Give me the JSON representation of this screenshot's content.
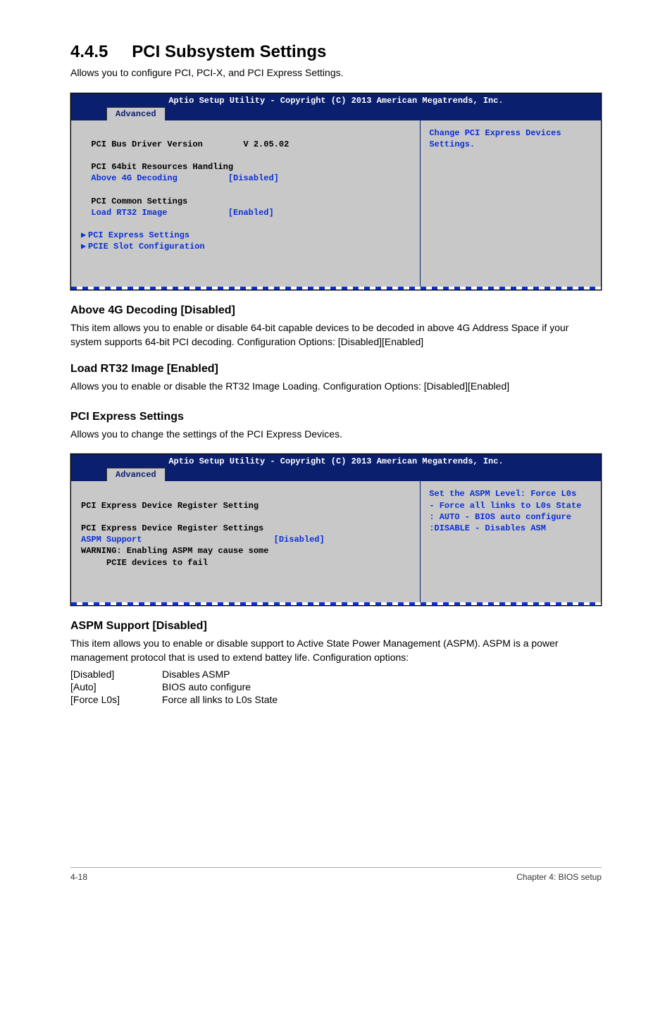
{
  "section": {
    "number": "4.4.5",
    "title": "PCI Subsystem Settings"
  },
  "intro": "Allows you to configure PCI, PCI-X, and PCI Express Settings.",
  "bios1": {
    "header": "Aptio Setup Utility - Copyright (C) 2013 American Megatrends, Inc.",
    "tab": "Advanced",
    "help": "Change PCI Express Devices Settings.",
    "lines": {
      "l1a": "PCI Bus Driver Version",
      "l1b": "V 2.05.02",
      "l2": "PCI 64bit Resources Handling",
      "l3a": "Above 4G Decoding",
      "l3b": "[Disabled]",
      "l4": "PCI Common Settings",
      "l5a": "Load RT32 Image",
      "l5b": "[Enabled]",
      "l6": "PCI Express Settings",
      "l7": "PCIE Slot Configuration"
    }
  },
  "s1": {
    "title": "Above 4G Decoding [Disabled]",
    "text": "This item allows you to enable or disable 64-bit capable devices to be decoded in above 4G Address Space if your system supports 64-bit PCI decoding. Configuration Options: [Disabled][Enabled]"
  },
  "s2": {
    "title": "Load RT32 Image [Enabled]",
    "text": "Allows you to enable or disable the RT32 Image Loading. Configuration Options: [Disabled][Enabled]"
  },
  "s3": {
    "title": "PCI Express Settings",
    "text": "Allows you to change the settings of the PCI Express Devices."
  },
  "bios2": {
    "header": "Aptio Setup Utility - Copyright (C) 2013 American Megatrends, Inc.",
    "tab": "Advanced",
    "help": "Set the ASPM Level: Force L0s\n- Force all links to L0s State\n: AUTO - BIOS auto configure :DISABLE - Disables ASM",
    "lines": {
      "l1": "PCI Express Device Register Setting",
      "l2": "PCI Express Device Register Settings",
      "l3a": "ASPM Support",
      "l3b": "[Disabled]",
      "l4": "WARNING: Enabling ASPM may cause some",
      "l5": "     PCIE devices to fail"
    }
  },
  "s4": {
    "title": "ASPM Support [Disabled]",
    "text": "This item allows you to enable or disable support to Active State Power Management (ASPM). ASPM is a power management protocol that is used to extend battey life. Configuration options:",
    "opts": [
      {
        "k": "[Disabled]",
        "v": "Disables ASMP"
      },
      {
        "k": "[Auto]",
        "v": "BIOS auto configure"
      },
      {
        "k": "[Force L0s]",
        "v": "Force all links to L0s State"
      }
    ]
  },
  "footer": {
    "left": "4-18",
    "right": "Chapter 4: BIOS setup"
  }
}
